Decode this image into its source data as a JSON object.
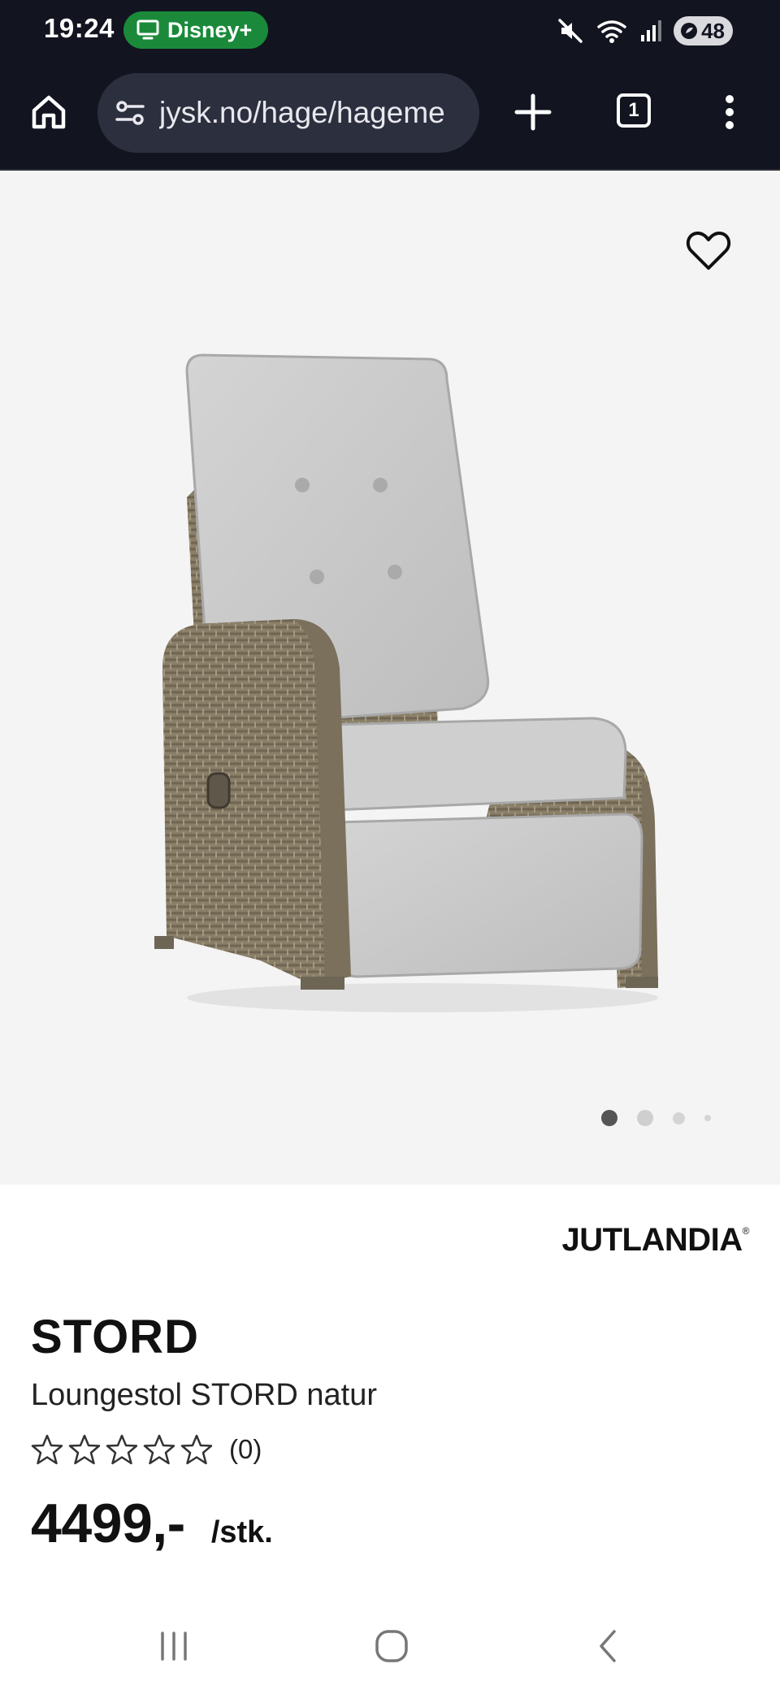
{
  "status_bar": {
    "time": "19:24",
    "cast_app": "Disney+",
    "battery": "48",
    "icons": [
      "tv-icon",
      "mute-icon",
      "wifi-icon",
      "signal-icon",
      "battery-icon"
    ]
  },
  "browser": {
    "url": "jysk.no/hage/hagemе",
    "tab_count": "1",
    "icons": [
      "home-icon",
      "site-settings-icon",
      "plus-icon",
      "tabs-icon",
      "more-vert-icon"
    ]
  },
  "gallery": {
    "image_alt": "Loungestol STORD natur",
    "total_images": 4,
    "active_index": 0,
    "favorite_icon": "heart-outline-icon"
  },
  "product": {
    "brand": "JUTLANDIA",
    "brand_mark": "®",
    "name": "STORD",
    "description": "Loungestol STORD natur",
    "rating_stars": 0,
    "rating_max": 5,
    "rating_count": "(0)",
    "price": "4499,-",
    "price_unit": "/stk."
  },
  "nav_bar": {
    "icons": [
      "recents-icon",
      "home-circle-icon",
      "back-icon"
    ]
  },
  "colors": {
    "status_bg": "#121420",
    "url_field_bg": "#2c2f3e",
    "disney_badge": "#1a8a3a",
    "hero_bg": "#f4f4f4",
    "text_dark": "#111111"
  }
}
